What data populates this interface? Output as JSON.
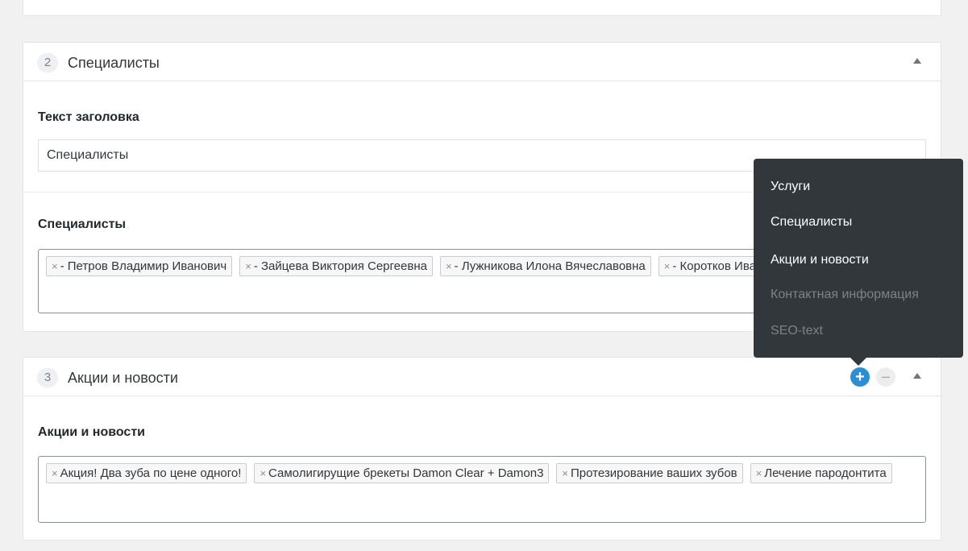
{
  "section2": {
    "number": "2",
    "title": "Специалисты",
    "heading_label": "Текст заголовка",
    "heading_value": "Специалисты",
    "relation_label": "Специалисты",
    "tags": [
      "- Петров Владимир Иванович",
      "- Зайцева Виктория Сергеевна",
      "- Лужникова Илона Вячеславовна",
      "- Коротков Иван Павлович"
    ]
  },
  "section3": {
    "number": "3",
    "title": "Акции и новости",
    "relation_label": "Акции и новости",
    "tags": [
      "Акция! Два зуба по цене одного!",
      "Самолигирущие брекеты Damon Clear + Damon3",
      "Протезирование ваших зубов",
      "Лечение пародонтита"
    ]
  },
  "tag_remove_glyph": "×",
  "controls": {
    "add_glyph": "+",
    "remove_glyph": "–"
  },
  "popup_menu": {
    "items": [
      {
        "label": "Услуги",
        "enabled": true
      },
      {
        "label": "Специалисты",
        "enabled": true
      },
      {
        "label": "Акции и новости",
        "enabled": true
      },
      {
        "label": "Контактная информация",
        "enabled": false
      },
      {
        "label": "SEO-text",
        "enabled": false
      }
    ]
  },
  "colors": {
    "accent": "#2a8fd4",
    "menu_bg": "#32373c"
  }
}
